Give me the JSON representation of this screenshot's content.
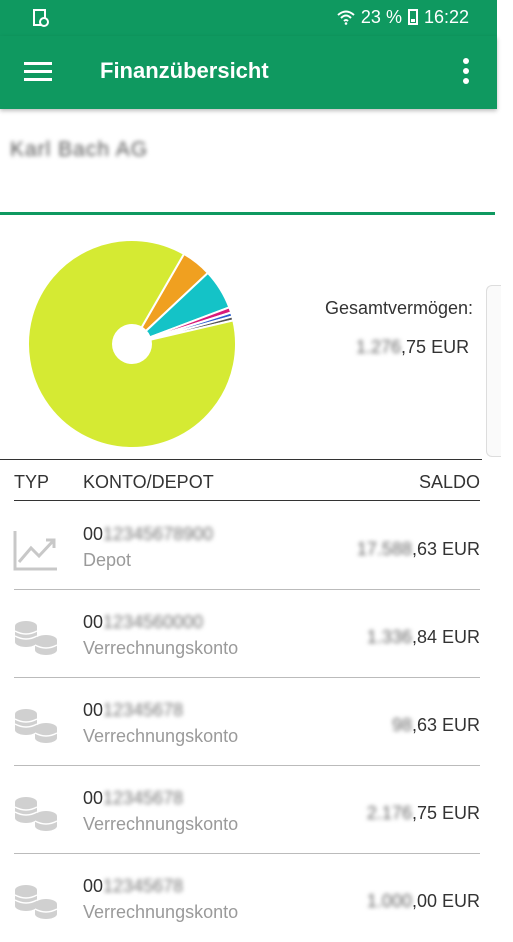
{
  "status_bar": {
    "battery": "23 %",
    "time": "16:22"
  },
  "app_bar": {
    "title": "Finanzübersicht",
    "menu_icon": "hamburger-menu-icon",
    "overflow_icon": "more-vert-icon"
  },
  "user": {
    "name": "Karl Bach AG"
  },
  "summary": {
    "total_label": "Gesamtvermögen:",
    "total_value_hidden": "1.276",
    "total_value_shown": ",75 EUR"
  },
  "chart_data": {
    "type": "pie",
    "slices": [
      {
        "value": 83.5,
        "color": "#d5ea33"
      },
      {
        "value": 4.5,
        "color": "#f0a020"
      },
      {
        "value": 6.0,
        "color": "#14c3c7"
      },
      {
        "value": 0.8,
        "color": "#d81b7a"
      },
      {
        "value": 0.6,
        "color": "#2d5fd0"
      },
      {
        "value": 0.6,
        "color": "#555555"
      }
    ],
    "donut_hole": true
  },
  "table": {
    "headers": {
      "typ": "TYP",
      "konto": "KONTO/DEPOT",
      "saldo": "SALDO"
    },
    "rows": [
      {
        "icon": "chart-line-icon",
        "acct_prefix": "00",
        "acct_hidden": "12345678900",
        "type": "Depot",
        "saldo_hidden": "17.588",
        "saldo_shown": ",63 EUR"
      },
      {
        "icon": "coins-icon",
        "acct_prefix": "00",
        "acct_hidden": "1234560000",
        "type": "Verrechnungskonto",
        "saldo_hidden": "1.336",
        "saldo_shown": ",84 EUR"
      },
      {
        "icon": "coins-icon",
        "acct_prefix": "00",
        "acct_hidden": "12345678",
        "type": "Verrechnungskonto",
        "saldo_hidden": "98",
        "saldo_shown": ",63 EUR"
      },
      {
        "icon": "coins-icon",
        "acct_prefix": "00",
        "acct_hidden": "12345678",
        "type": "Verrechnungskonto",
        "saldo_hidden": "2.176",
        "saldo_shown": ",75 EUR"
      },
      {
        "icon": "coins-icon",
        "acct_prefix": "00",
        "acct_hidden": "12345678",
        "type": "Verrechnungskonto",
        "saldo_hidden": "1.000",
        "saldo_shown": ",00 EUR"
      }
    ]
  }
}
